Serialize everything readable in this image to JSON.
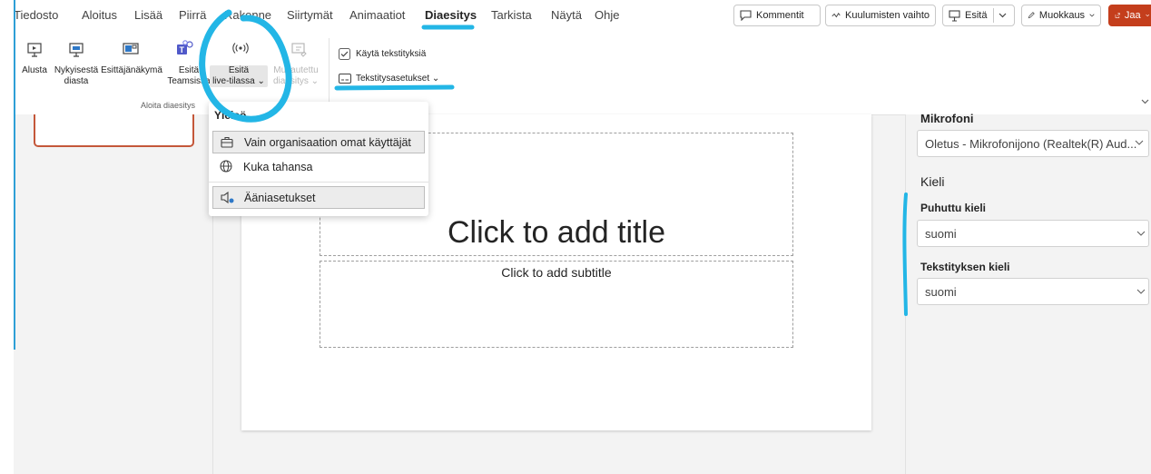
{
  "menubar": {
    "tabs": [
      "Tiedosto",
      "Aloitus",
      "Lisää",
      "Piirrä",
      "Rakenne",
      "Siirtymät",
      "Animaatiot",
      "Diaesitys",
      "Tarkista",
      "Näytä",
      "Ohje"
    ],
    "active_tab": "Diaesitys",
    "comments_label": "Kommentit",
    "catchup_label": "Kuulumisten vaihto",
    "present_label": "Esitä",
    "edit_label": "Muokkaus",
    "share_label": "Jaa",
    "share_color": "#c43e1c"
  },
  "ribbon": {
    "start_from_beginning": "Alusta",
    "from_current_1": "Nykyisestä",
    "from_current_2": "diasta",
    "presenter_view": "Esittäjänäkymä",
    "present_teams_1": "Esitä",
    "present_teams_2": "Teamsissa",
    "present_live_1": "Esitä",
    "present_live_2": "live-tilassa",
    "custom_show_1": "Mukautettu",
    "custom_show_2": "diaesitys",
    "group_start": "Aloita diaesitys",
    "use_subtitles": "Käytä tekstityksiä",
    "subtitle_settings": "Tekstitysasetukset"
  },
  "dropdown": {
    "header": "Yleisö",
    "items": [
      "Vain organisaation omat käyttäjät",
      "Kuka tahansa",
      "Ääniasetukset"
    ]
  },
  "slide": {
    "title_placeholder": "Click to add title",
    "subtitle_placeholder": "Click to add subtitle"
  },
  "right_panel": {
    "microphone_label": "Mikrofoni",
    "microphone_value": "Oletus - Mikrofonijono (Realtek(R) Aud...",
    "language_heading": "Kieli",
    "spoken_language_label": "Puhuttu kieli",
    "spoken_language_value": "suomi",
    "subtitle_language_label": "Tekstityksen kieli",
    "subtitle_language_value": "suomi"
  },
  "colors": {
    "annotation": "#23b6e6",
    "accent_red": "#c43e1c"
  }
}
